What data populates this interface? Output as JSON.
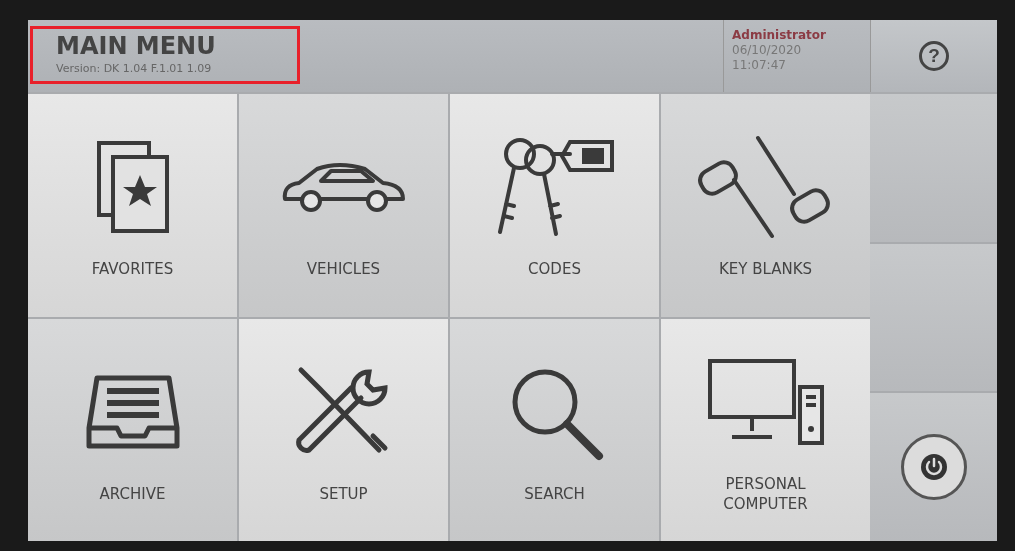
{
  "header": {
    "title": "MAIN MENU",
    "version": "Version: DK 1.04 F.1.01 1.09",
    "user": "Administrator",
    "date": "06/10/2020",
    "time": "11:07:47"
  },
  "help_button": {
    "label": "?"
  },
  "tiles": [
    {
      "kind": "favorites",
      "label": "FAVORITES"
    },
    {
      "kind": "vehicles",
      "label": "VEHICLES"
    },
    {
      "kind": "codes",
      "label": "CODES"
    },
    {
      "kind": "blanks",
      "label": "KEY BLANKS"
    },
    {
      "kind": "archive",
      "label": "ARCHIVE"
    },
    {
      "kind": "setup",
      "label": "SETUP"
    },
    {
      "kind": "search",
      "label": "SEARCH"
    },
    {
      "kind": "computer",
      "label": "PERSONAL COMPUTER"
    }
  ],
  "highlight": {
    "visible": true
  }
}
